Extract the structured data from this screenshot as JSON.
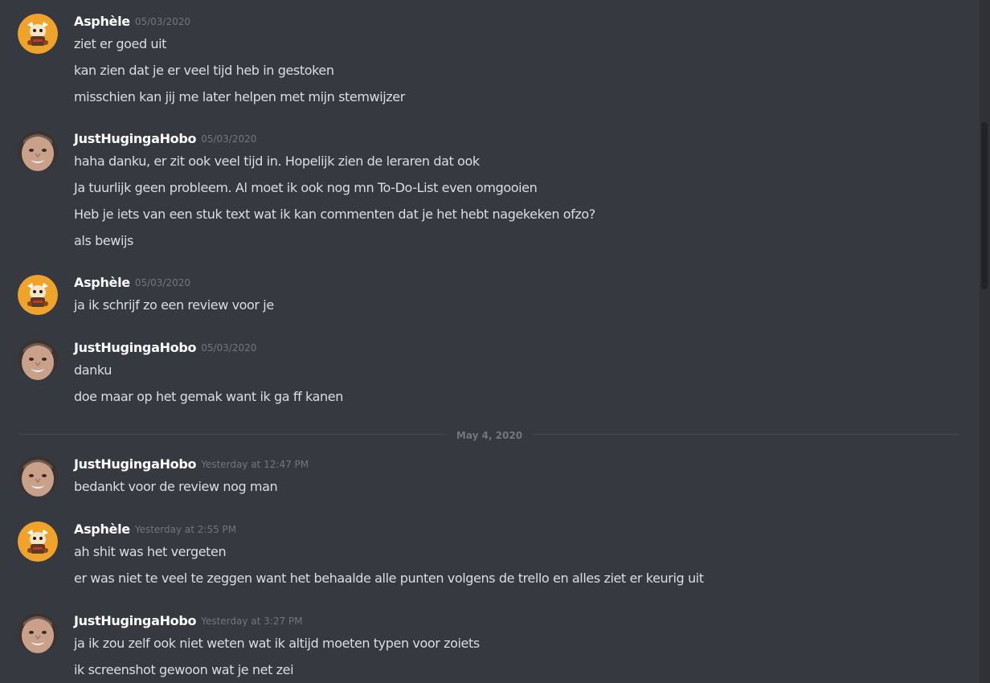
{
  "messages": [
    {
      "author": "Asphèle",
      "timestamp": "05/03/2020",
      "avatar": "asphele-avatar-icon",
      "lines": [
        "ziet er goed uit",
        "kan zien dat je er veel tijd heb in gestoken",
        "misschien kan jij me later helpen met mijn stemwijzer"
      ]
    },
    {
      "author": "JustHugingaHobo",
      "timestamp": "05/03/2020",
      "avatar": "justhugingahobo-avatar-icon",
      "lines": [
        "haha danku, er zit ook veel tijd in. Hopelijk zien de leraren dat ook",
        "Ja tuurlijk geen probleem. Al moet ik ook nog mn To-Do-List even omgooien",
        "Heb je iets van een stuk text wat ik kan commenten dat je het hebt nagekeken ofzo?",
        "als bewijs"
      ]
    },
    {
      "author": "Asphèle",
      "timestamp": "05/03/2020",
      "avatar": "asphele-avatar-icon",
      "lines": [
        "ja ik schrijf zo een review voor je"
      ]
    },
    {
      "author": "JustHugingaHobo",
      "timestamp": "05/03/2020",
      "avatar": "justhugingahobo-avatar-icon",
      "lines": [
        "danku",
        "doe maar op het gemak want ik ga ff kanen"
      ]
    },
    {
      "author": "JustHugingaHobo",
      "timestamp": "Yesterday at 12:47 PM",
      "avatar": "justhugingahobo-avatar-icon",
      "lines": [
        "bedankt voor de review nog man"
      ]
    },
    {
      "author": "Asphèle",
      "timestamp": "Yesterday at 2:55 PM",
      "avatar": "asphele-avatar-icon",
      "lines": [
        "ah shit was het vergeten",
        "er was niet te veel te zeggen want het behaalde alle punten volgens de trello en alles ziet er keurig uit"
      ]
    },
    {
      "author": "JustHugingaHobo",
      "timestamp": "Yesterday at 3:27 PM",
      "avatar": "justhugingahobo-avatar-icon",
      "lines": [
        "ja ik zou zelf ook niet weten wat ik altijd moeten typen voor zoiets",
        "ik screenshot gewoon wat je net zei"
      ]
    }
  ],
  "date_divider": "May 4, 2020",
  "colors": {
    "background": "#36393f",
    "author_text": "#ffffff",
    "message_text": "#dcddde",
    "timestamp_text": "#72767d",
    "asphele_avatar_bg": "#f0a32c"
  }
}
